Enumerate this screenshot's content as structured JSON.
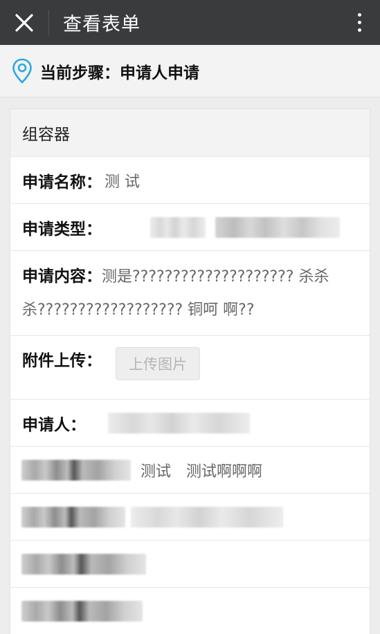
{
  "header": {
    "title": "查看表单"
  },
  "step": {
    "label": "当前步骤：",
    "value": "申请人申请"
  },
  "form": {
    "group_title": "组容器",
    "fields": [
      {
        "label": "申请名称：",
        "value": "测 试"
      },
      {
        "label": "申请类型：",
        "value": ""
      },
      {
        "label": "申请内容：",
        "value": "测是???????????????????? 杀杀杀?????????????????? 铜呵 啊??"
      },
      {
        "label": "附件上传：",
        "button": "上传图片"
      },
      {
        "label": "申请人：",
        "value": ""
      }
    ],
    "extra_row_values": [
      "测试",
      "测试啊啊啊"
    ]
  },
  "colors": {
    "topbar": "#3a3b3d",
    "pin": "#2aa9e0",
    "background": "#ededed"
  },
  "icons": {
    "close": "close-icon",
    "more": "more-vertical-icon",
    "pin": "location-pin-icon"
  }
}
